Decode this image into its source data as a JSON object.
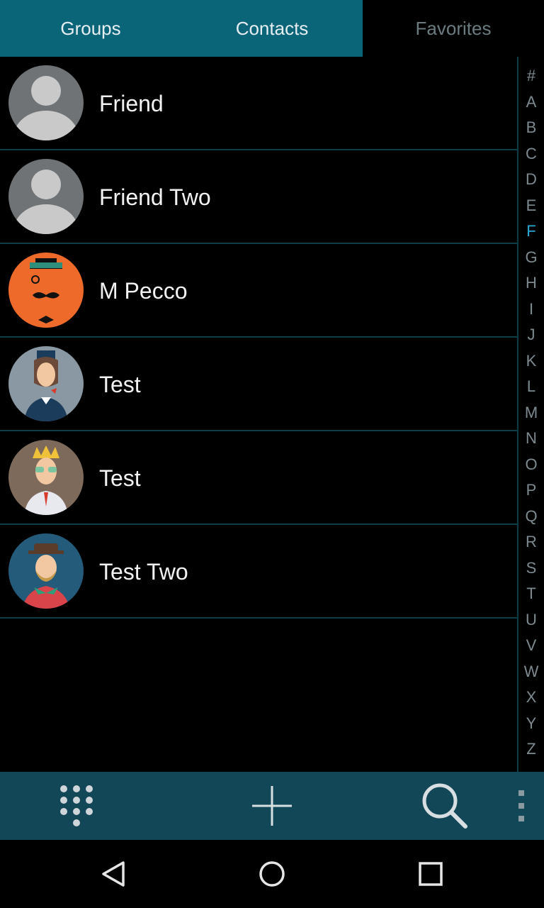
{
  "tabs": [
    {
      "label": "Groups",
      "selected": true
    },
    {
      "label": "Contacts",
      "selected": true
    },
    {
      "label": "Favorites",
      "selected": false
    }
  ],
  "contacts": [
    {
      "name": "Friend",
      "avatar": "default-avatar-icon"
    },
    {
      "name": "Friend Two",
      "avatar": "default-avatar-icon"
    },
    {
      "name": "M Pecco",
      "avatar": "mustache-hat-avatar"
    },
    {
      "name": "Test",
      "avatar": "captain-avatar"
    },
    {
      "name": "Test",
      "avatar": "blond-sunglasses-avatar"
    },
    {
      "name": "Test Two",
      "avatar": "bearded-hat-avatar"
    }
  ],
  "index": {
    "letters": [
      "#",
      "A",
      "B",
      "C",
      "D",
      "E",
      "F",
      "G",
      "H",
      "I",
      "J",
      "K",
      "L",
      "M",
      "N",
      "O",
      "P",
      "Q",
      "R",
      "S",
      "T",
      "U",
      "V",
      "W",
      "X",
      "Y",
      "Z"
    ],
    "active": "F"
  },
  "bottom_bar": {
    "icons": [
      "dialpad-icon",
      "add-icon",
      "search-icon",
      "more-vert-icon"
    ]
  },
  "nav_bar": {
    "icons": [
      "back-icon",
      "home-icon",
      "recents-icon"
    ]
  },
  "colors": {
    "tab_selected": "#0a6578",
    "bottom_bar": "#114757",
    "divider": "#0d3b46",
    "index_active": "#29a9d1"
  }
}
